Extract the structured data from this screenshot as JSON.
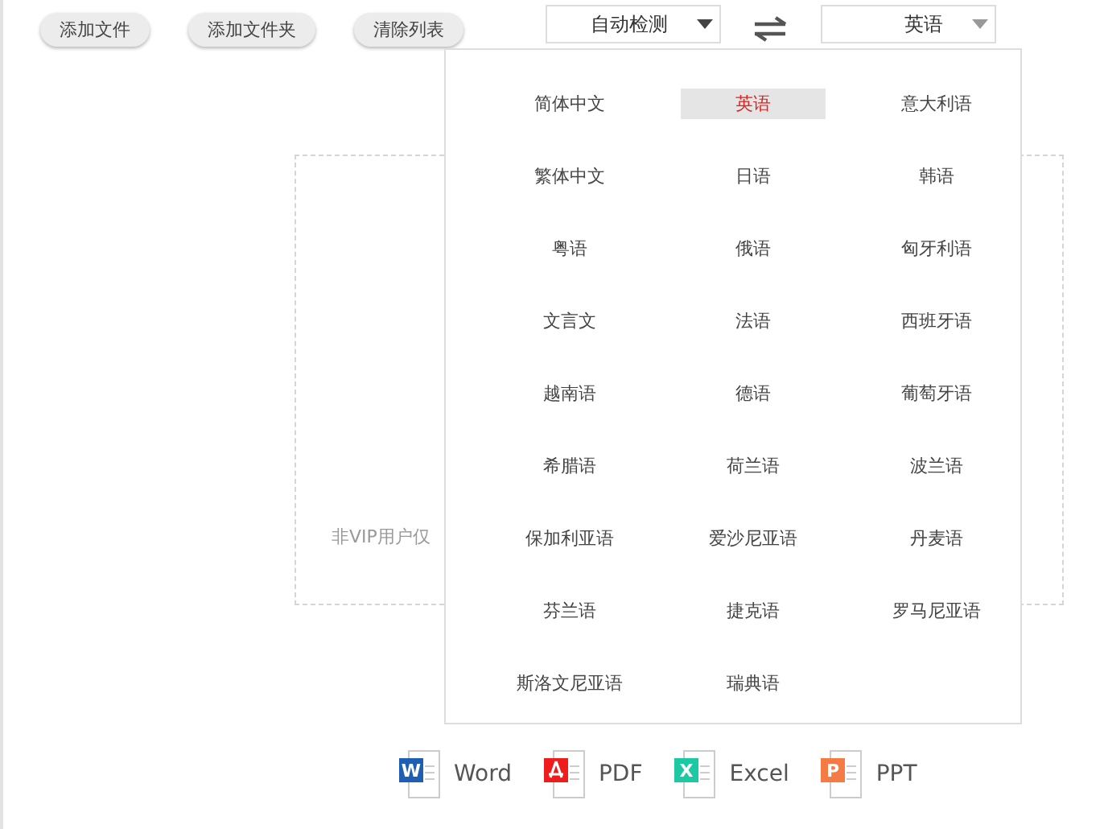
{
  "toolbar": {
    "buttons": [
      "添加文件",
      "添加文件夹",
      "清除列表"
    ]
  },
  "source_language": {
    "value": "自动检测",
    "expanded": false
  },
  "target_language": {
    "value": "英语",
    "expanded": true
  },
  "language_menu": {
    "options": [
      {
        "label": "简体中文",
        "selected": false
      },
      {
        "label": "英语",
        "selected": true
      },
      {
        "label": "意大利语",
        "selected": false
      },
      {
        "label": "繁体中文",
        "selected": false
      },
      {
        "label": "日语",
        "selected": false
      },
      {
        "label": "韩语",
        "selected": false
      },
      {
        "label": "粤语",
        "selected": false
      },
      {
        "label": "俄语",
        "selected": false
      },
      {
        "label": "匈牙利语",
        "selected": false
      },
      {
        "label": "文言文",
        "selected": false
      },
      {
        "label": "法语",
        "selected": false
      },
      {
        "label": "西班牙语",
        "selected": false
      },
      {
        "label": "越南语",
        "selected": false
      },
      {
        "label": "德语",
        "selected": false
      },
      {
        "label": "葡萄牙语",
        "selected": false
      },
      {
        "label": "希腊语",
        "selected": false
      },
      {
        "label": "荷兰语",
        "selected": false
      },
      {
        "label": "波兰语",
        "selected": false
      },
      {
        "label": "保加利亚语",
        "selected": false
      },
      {
        "label": "爱沙尼亚语",
        "selected": false
      },
      {
        "label": "丹麦语",
        "selected": false
      },
      {
        "label": "芬兰语",
        "selected": false
      },
      {
        "label": "捷克语",
        "selected": false
      },
      {
        "label": "罗马尼亚语",
        "selected": false
      },
      {
        "label": "斯洛文尼亚语",
        "selected": false
      },
      {
        "label": "瑞典语",
        "selected": false
      }
    ]
  },
  "drop_zone": {
    "note": "非VIP用户仅"
  },
  "formats": [
    {
      "kind": "word",
      "badge": "W",
      "label": "Word"
    },
    {
      "kind": "pdf",
      "label": "PDF"
    },
    {
      "kind": "excel",
      "badge": "X",
      "label": "Excel"
    },
    {
      "kind": "ppt",
      "badge": "P",
      "label": "PPT"
    }
  ]
}
